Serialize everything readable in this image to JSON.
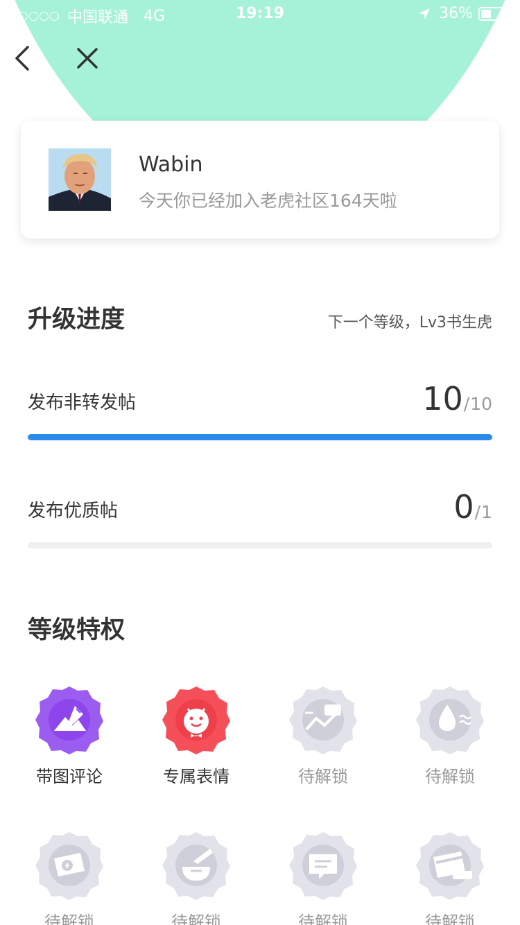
{
  "status_bar": {
    "carrier": "中国联通",
    "network": "4G",
    "time": "19:19",
    "battery": "36%",
    "battery_level": 0.36,
    "signal_bars": 1
  },
  "nav": {
    "back_icon": "chevron-left-icon",
    "close_icon": "close-icon"
  },
  "profile": {
    "name": "Wabin",
    "join_text": "今天你已经加入老虎社区164天啦"
  },
  "upgrade": {
    "title": "升级进度",
    "next_level": "下一个等级，Lv3书生虎",
    "tasks": [
      {
        "label": "发布非转发帖",
        "current": "10",
        "separator": "/",
        "total": "10",
        "progress": 1.0
      },
      {
        "label": "发布优质帖",
        "current": "0",
        "separator": "/",
        "total": "1",
        "progress": 0.0
      }
    ]
  },
  "privileges": {
    "title": "等级特权",
    "items": [
      {
        "label": "带图评论",
        "icon": "image-comment-icon",
        "locked": false
      },
      {
        "label": "专属表情",
        "icon": "tiger-emoji-icon",
        "locked": false
      },
      {
        "label": "待解锁",
        "icon": "chart-icon",
        "locked": true
      },
      {
        "label": "待解锁",
        "icon": "drop-icon",
        "locked": true
      },
      {
        "label": "待解锁",
        "icon": "ticket-icon",
        "locked": true
      },
      {
        "label": "待解锁",
        "icon": "pen-icon",
        "locked": true
      },
      {
        "label": "待解锁",
        "icon": "message-icon",
        "locked": true
      },
      {
        "label": "待解锁",
        "icon": "free-card-icon",
        "locked": true
      }
    ]
  },
  "colors": {
    "header_bg": "#a5f2d9",
    "progress_blue": "#2a89ea",
    "badge_purple": "#9b5cf0",
    "badge_red": "#f5505a",
    "locked_gray": "#d5d5df"
  }
}
